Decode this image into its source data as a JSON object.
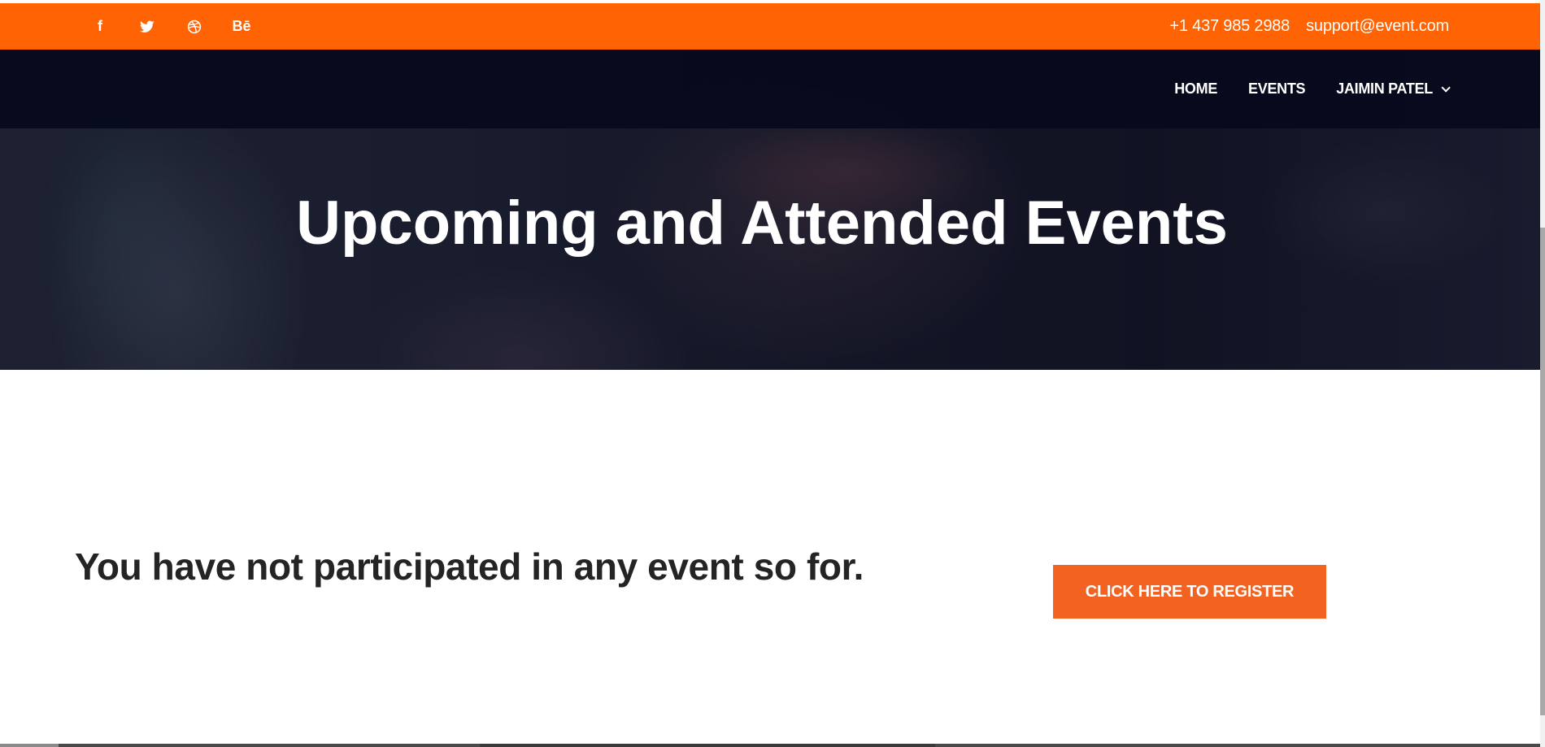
{
  "topbar": {
    "socials": [
      {
        "icon": "facebook-icon",
        "glyph": "f"
      },
      {
        "icon": "twitter-icon",
        "glyph": ""
      },
      {
        "icon": "dribbble-icon",
        "glyph": ""
      },
      {
        "icon": "behance-icon",
        "glyph": "Bē"
      }
    ],
    "phone": "+1 437 985 2988",
    "email": "support@event.com"
  },
  "nav": {
    "items": [
      {
        "label": "HOME"
      },
      {
        "label": "EVENTS"
      },
      {
        "label": "JAIMIN PATEL"
      }
    ]
  },
  "hero": {
    "title": "Upcoming and Attended Events"
  },
  "main": {
    "message": "You have not participated in any event so for.",
    "register_label": "CLICK HERE TO REGISTER"
  },
  "colors": {
    "accent": "#ff6303",
    "button": "#f26321",
    "nav_bg": "#070a1c",
    "text_dark": "#242424"
  }
}
